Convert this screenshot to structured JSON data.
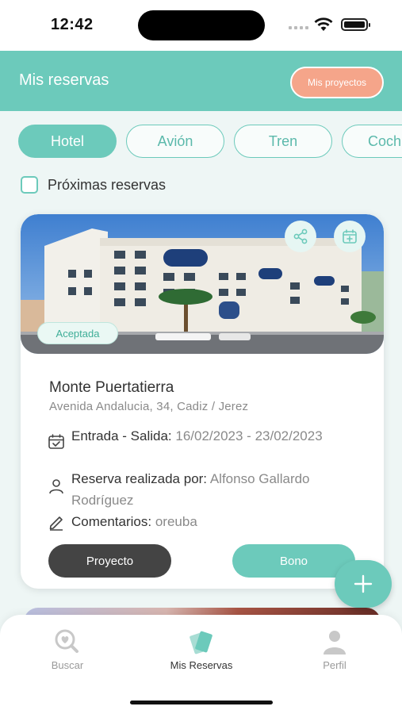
{
  "status_bar": {
    "time": "12:42"
  },
  "header": {
    "title": "Mis reservas",
    "projects_button": "Mis proyectos"
  },
  "tabs": [
    {
      "label": "Hotel",
      "active": true
    },
    {
      "label": "Avión",
      "active": false
    },
    {
      "label": "Tren",
      "active": false
    },
    {
      "label": "Coch",
      "active": false
    }
  ],
  "filter": {
    "label": "Próximas reservas",
    "checked": false
  },
  "reservation": {
    "status": "Aceptada",
    "hotel_name": "Monte Puertatierra",
    "address": "Avenida Andalucia, 34, Cadiz / Jerez",
    "dates_label": "Entrada - Salida:",
    "dates_value": "16/02/2023 - 23/02/2023",
    "booked_by_label": "Reserva realizada por:",
    "booked_by_value": "Alfonso Gallardo Rodríguez",
    "comments_label": "Comentarios:",
    "comments_value": "oreuba",
    "project_button": "Proyecto",
    "voucher_button": "Bono"
  },
  "bottom_nav": {
    "items": [
      {
        "label": "Buscar",
        "icon": "search-heart-icon"
      },
      {
        "label": "Mis Reservas",
        "icon": "tickets-icon"
      },
      {
        "label": "Perfil",
        "icon": "user-icon"
      }
    ]
  },
  "colors": {
    "accent": "#6ccabb",
    "secondary": "#f5a58a",
    "dark": "#444444"
  }
}
